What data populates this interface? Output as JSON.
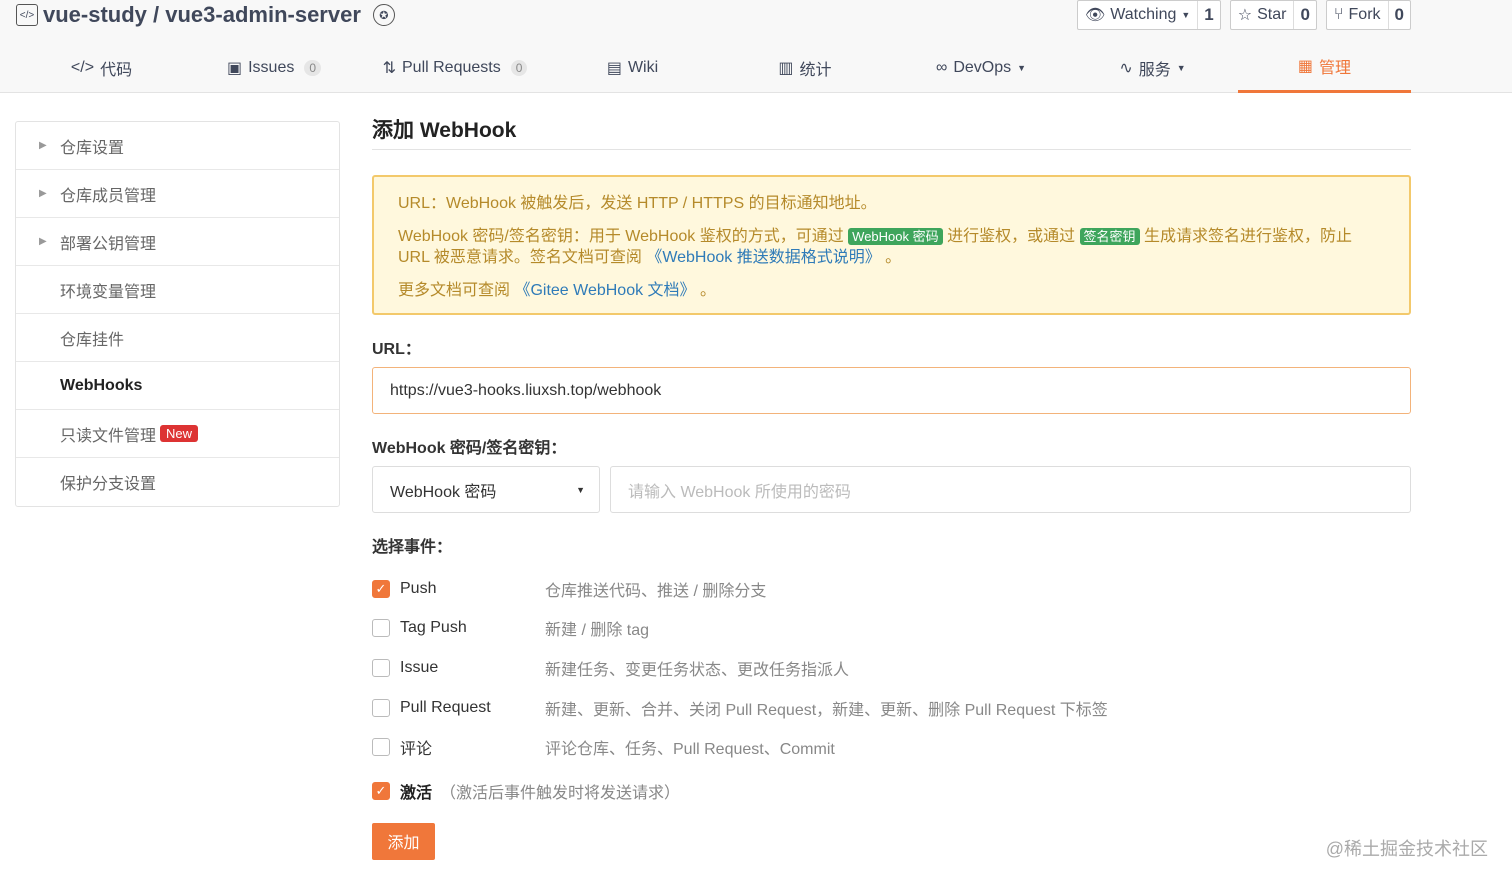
{
  "header": {
    "repo_title": "vue-study / vue3-admin-server",
    "watch_label": "Watching",
    "watch_count": "1",
    "star_label": "Star",
    "star_count": "0",
    "fork_label": "Fork",
    "fork_count": "0"
  },
  "tabs": [
    {
      "label": "代码",
      "icon": "code-icon"
    },
    {
      "label": "Issues",
      "count": "0",
      "icon": "issues-icon"
    },
    {
      "label": "Pull Requests",
      "count": "0",
      "icon": "pull-request-icon"
    },
    {
      "label": "Wiki",
      "icon": "wiki-icon"
    },
    {
      "label": "统计",
      "icon": "chart-icon"
    },
    {
      "label": "DevOps",
      "icon": "infinity-icon"
    },
    {
      "label": "服务",
      "icon": "pulse-icon"
    },
    {
      "label": "管理",
      "icon": "manage-icon",
      "active": true
    }
  ],
  "sidebar": {
    "items": [
      {
        "label": "仓库设置"
      },
      {
        "label": "仓库成员管理"
      },
      {
        "label": "部署公钥管理"
      },
      {
        "label": "环境变量管理"
      },
      {
        "label": "仓库挂件"
      },
      {
        "label": "WebHooks"
      },
      {
        "label": "只读文件管理",
        "badge": "New"
      },
      {
        "label": "保护分支设置"
      }
    ]
  },
  "main": {
    "title": "添加 WebHook",
    "notice": {
      "line1": "URL：WebHook 被触发后，发送 HTTP / HTTPS 的目标通知地址。",
      "line2_a": "WebHook 密码/签名密钥：用于 WebHook 鉴权的方式，可通过 ",
      "tag1": "WebHook 密码",
      "line2_b": " 进行鉴权，或通过 ",
      "tag2": "签名密钥",
      "line2_c": " 生成请求签名进行鉴权，防止 URL 被恶意请求。签名文档可查阅 ",
      "link1": "《WebHook 推送数据格式说明》",
      "line2_d": " 。",
      "line3_a": "更多文档可查阅 ",
      "link2": "《Gitee WebHook 文档》",
      "line3_b": " 。"
    },
    "url_label": "URL：",
    "url_value": "https://vue3-hooks.liuxsh.top/webhook",
    "secret_label": "WebHook 密码/签名密钥：",
    "secret_select": "WebHook 密码",
    "secret_placeholder": "请输入 WebHook 所使用的密码",
    "events_label": "选择事件：",
    "events": [
      {
        "name": "Push",
        "desc": "仓库推送代码、推送 / 删除分支",
        "checked": true
      },
      {
        "name": "Tag Push",
        "desc": "新建 / 删除 tag",
        "checked": false
      },
      {
        "name": "Issue",
        "desc": "新建任务、变更任务状态、更改任务指派人",
        "checked": false
      },
      {
        "name": "Pull Request",
        "desc": "新建、更新、合并、关闭 Pull Request，新建、更新、删除 Pull Request 下标签",
        "checked": false
      },
      {
        "name": "评论",
        "desc": "评论仓库、任务、Pull Request、Commit",
        "checked": false
      }
    ],
    "activate_label": "激活",
    "activate_hint": "（激活后事件触发时将发送请求）",
    "add_button": "添加"
  },
  "watermark": "@稀土掘金技术社区",
  "colors": {
    "accent": "#f0773a",
    "notice_bg": "#fff8dd",
    "notice_border": "#f3c96b",
    "tag_green": "#3ea55c",
    "badge_red": "#dd3333"
  }
}
